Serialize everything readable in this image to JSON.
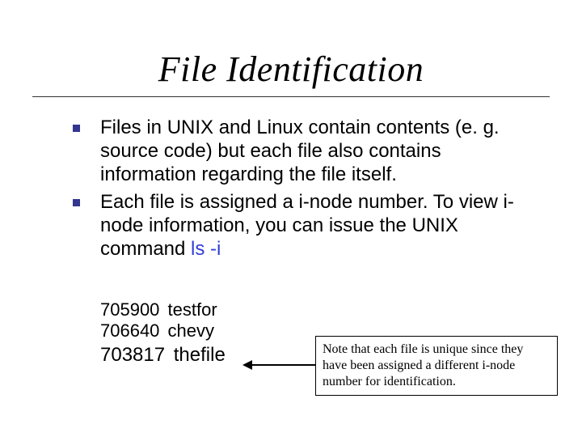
{
  "title": "File Identification",
  "bullets": [
    "Files in UNIX and Linux contain contents (e. g. source code) but each file also contains information regarding the file itself.",
    "Each file is assigned a i-node number. To view i-node information, you can issue the UNIX command "
  ],
  "command": "ls -i",
  "inode_listing": [
    {
      "num": "705900",
      "name": "testfor"
    },
    {
      "num": "706640",
      "name": "chevy"
    },
    {
      "num": "703817",
      "name": "thefile"
    }
  ],
  "note": "Note that each file is unique since they have been assigned a different i-node number for identification."
}
